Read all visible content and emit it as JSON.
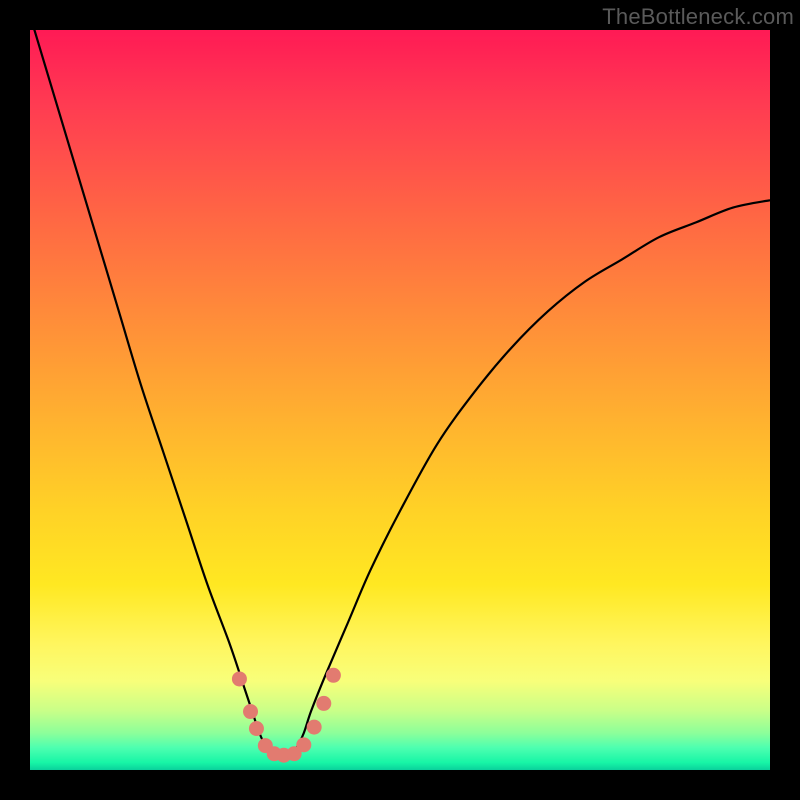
{
  "watermark": "TheBottleneck.com",
  "colors": {
    "frame": "#000000",
    "curve": "#000000",
    "markers": "#e27b70",
    "gradient_top": "#ff1a55",
    "gradient_bottom": "#0ad19c"
  },
  "chart_data": {
    "type": "line",
    "title": "",
    "xlabel": "",
    "ylabel": "",
    "xlim": [
      0,
      1
    ],
    "ylim": [
      0,
      1
    ],
    "x": [
      0.0,
      0.03,
      0.06,
      0.09,
      0.12,
      0.15,
      0.18,
      0.21,
      0.24,
      0.27,
      0.29,
      0.3,
      0.31,
      0.32,
      0.33,
      0.34,
      0.35,
      0.36,
      0.37,
      0.38,
      0.4,
      0.43,
      0.46,
      0.5,
      0.55,
      0.6,
      0.65,
      0.7,
      0.75,
      0.8,
      0.85,
      0.9,
      0.95,
      1.0
    ],
    "y": [
      1.02,
      0.92,
      0.82,
      0.72,
      0.62,
      0.52,
      0.43,
      0.34,
      0.25,
      0.17,
      0.11,
      0.08,
      0.05,
      0.03,
      0.02,
      0.02,
      0.02,
      0.03,
      0.05,
      0.08,
      0.13,
      0.2,
      0.27,
      0.35,
      0.44,
      0.51,
      0.57,
      0.62,
      0.66,
      0.69,
      0.72,
      0.74,
      0.76,
      0.77
    ],
    "annotations": {
      "markers_x": [
        0.283,
        0.298,
        0.306,
        0.318,
        0.33,
        0.343,
        0.357,
        0.37,
        0.384,
        0.397,
        0.41
      ],
      "markers_y": [
        0.123,
        0.079,
        0.056,
        0.033,
        0.022,
        0.02,
        0.022,
        0.034,
        0.058,
        0.09,
        0.128
      ]
    }
  }
}
